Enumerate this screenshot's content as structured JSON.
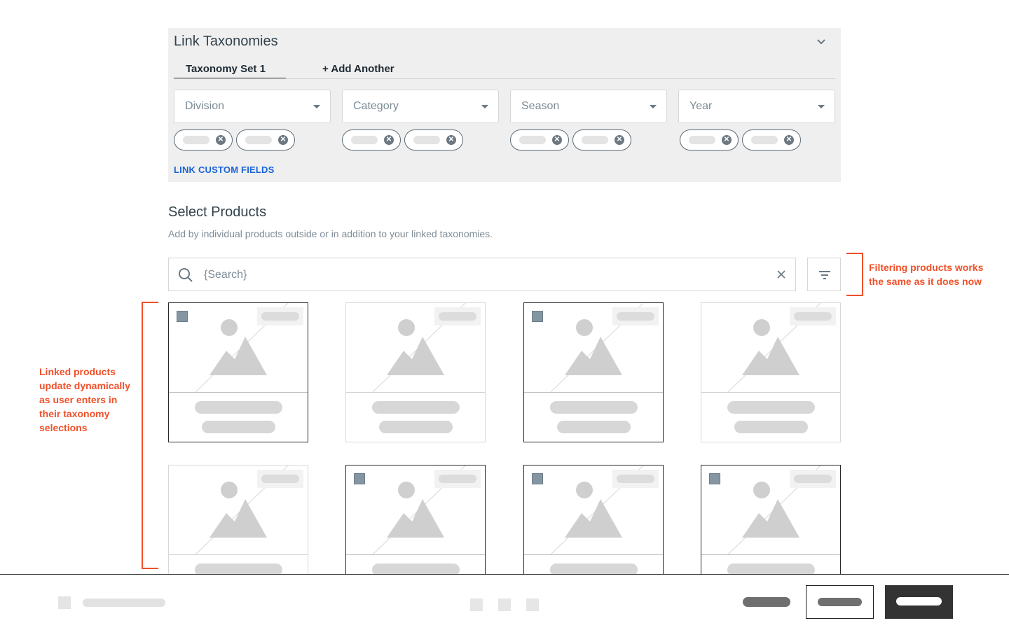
{
  "link_taxonomies": {
    "title": "Link Taxonomies",
    "tabs": [
      {
        "label": "Taxonomy Set 1",
        "active": true
      },
      {
        "label": "+ Add Another",
        "active": false
      }
    ],
    "dropdowns": [
      {
        "label": "Division"
      },
      {
        "label": "Category"
      },
      {
        "label": "Season"
      },
      {
        "label": "Year"
      }
    ],
    "link_custom_fields_label": "LINK CUSTOM FIELDS"
  },
  "select_products": {
    "title": "Select Products",
    "subtitle": "Add by individual products outside or in addition to your linked taxonomies.",
    "search": {
      "placeholder": "{Search}"
    }
  },
  "annotations": {
    "filtering_note": "Filtering products works the same as it does now",
    "linked_note": "Linked products update dynamically as user enters in their taxonomy selections"
  },
  "products": [
    {
      "selected": true
    },
    {
      "selected": false
    },
    {
      "selected": true
    },
    {
      "selected": false
    },
    {
      "selected": false
    },
    {
      "selected": true
    },
    {
      "selected": true
    },
    {
      "selected": true
    }
  ],
  "colors": {
    "accent_link": "#1a63d8",
    "annotation": "#f0502a",
    "primary_button": "#333333"
  },
  "icons": {
    "collapse": "chevron-down-icon",
    "search": "search-icon",
    "clear": "close-icon",
    "filter": "filter-icon",
    "chip_remove": "remove-chip-icon"
  }
}
